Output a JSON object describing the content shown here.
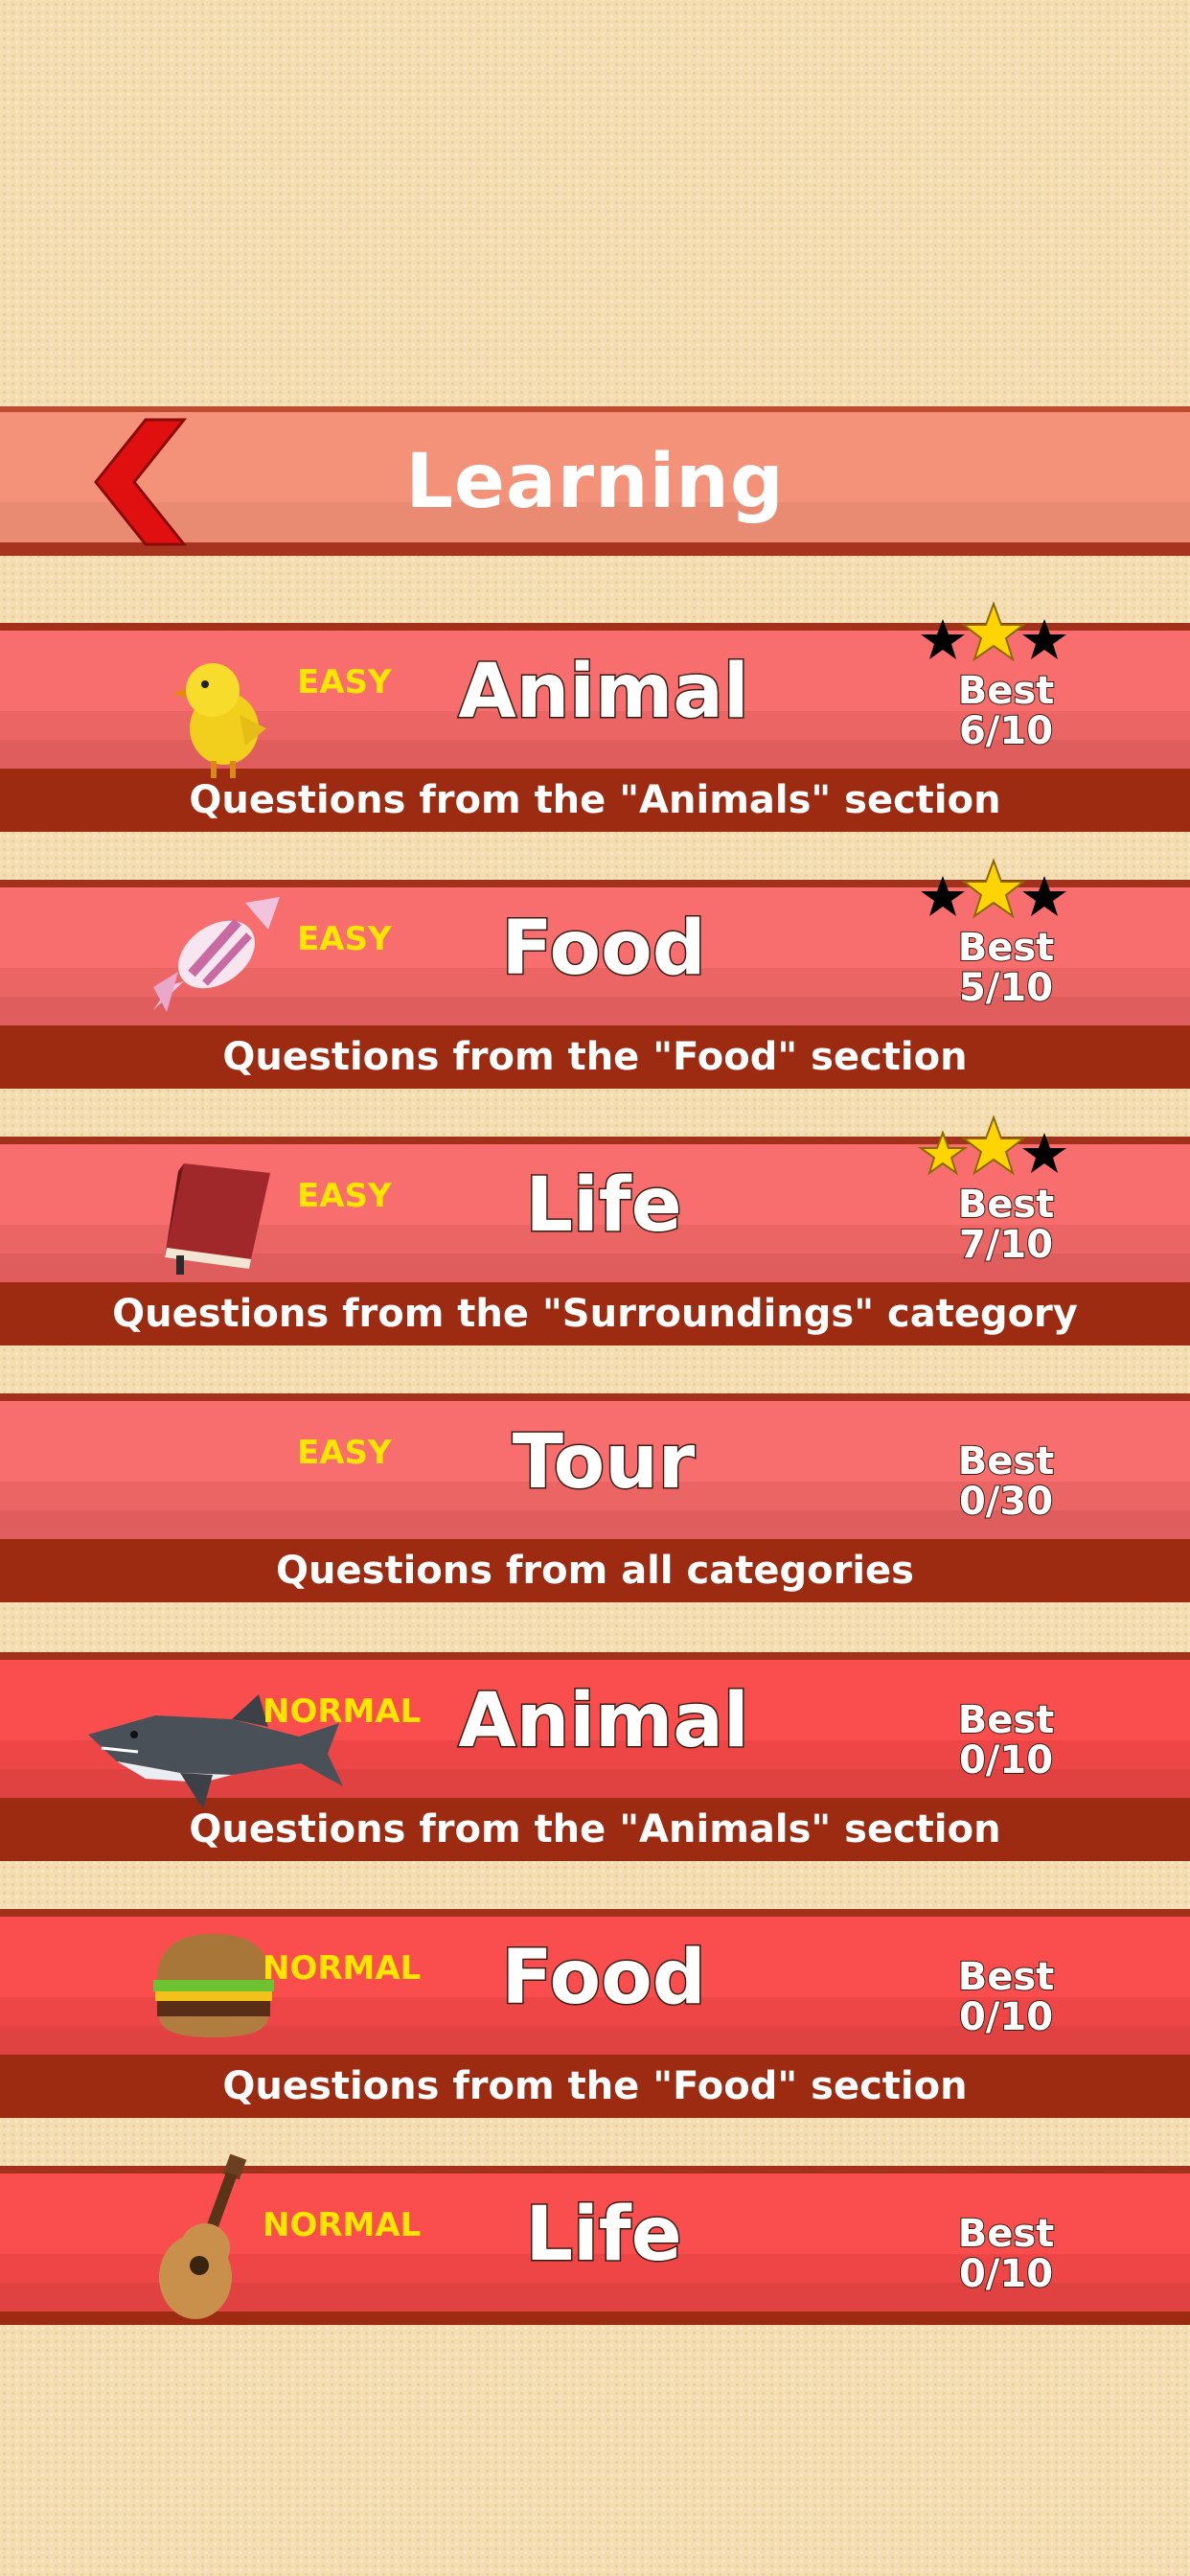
{
  "header": {
    "title": "Learning",
    "back_icon": "chevron-left-icon",
    "accent": "#e01010"
  },
  "cards": [
    {
      "difficulty": "EASY",
      "name": "Animal",
      "best_label": "Best",
      "best_score": "6/10",
      "description": "Questions from the \"Animals\" section",
      "stars_earned": 1,
      "stars_total": 3,
      "icon": "chick-icon"
    },
    {
      "difficulty": "EASY",
      "name": "Food",
      "best_label": "Best",
      "best_score": "5/10",
      "description": "Questions from the \"Food\" section",
      "stars_earned": 1,
      "stars_total": 3,
      "icon": "candy-icon"
    },
    {
      "difficulty": "EASY",
      "name": "Life",
      "best_label": "Best",
      "best_score": "7/10",
      "description": "Questions from the \"Surroundings\" category",
      "stars_earned": 2,
      "stars_total": 3,
      "icon": "book-icon"
    },
    {
      "difficulty": "EASY",
      "name": "Tour",
      "best_label": "Best",
      "best_score": "0/30",
      "description": "Questions from all categories",
      "stars_earned": 0,
      "stars_total": 0,
      "icon": ""
    },
    {
      "difficulty": "NORMAL",
      "name": "Animal",
      "best_label": "Best",
      "best_score": "0/10",
      "description": "Questions from the \"Animals\" section",
      "stars_earned": 0,
      "stars_total": 0,
      "icon": "shark-icon"
    },
    {
      "difficulty": "NORMAL",
      "name": "Food",
      "best_label": "Best",
      "best_score": "0/10",
      "description": "Questions from the \"Food\" section",
      "stars_earned": 0,
      "stars_total": 0,
      "icon": "burger-icon"
    },
    {
      "difficulty": "NORMAL",
      "name": "Life",
      "best_label": "Best",
      "best_score": "0/10",
      "description": "",
      "stars_earned": 0,
      "stars_total": 0,
      "icon": "guitar-icon"
    }
  ]
}
